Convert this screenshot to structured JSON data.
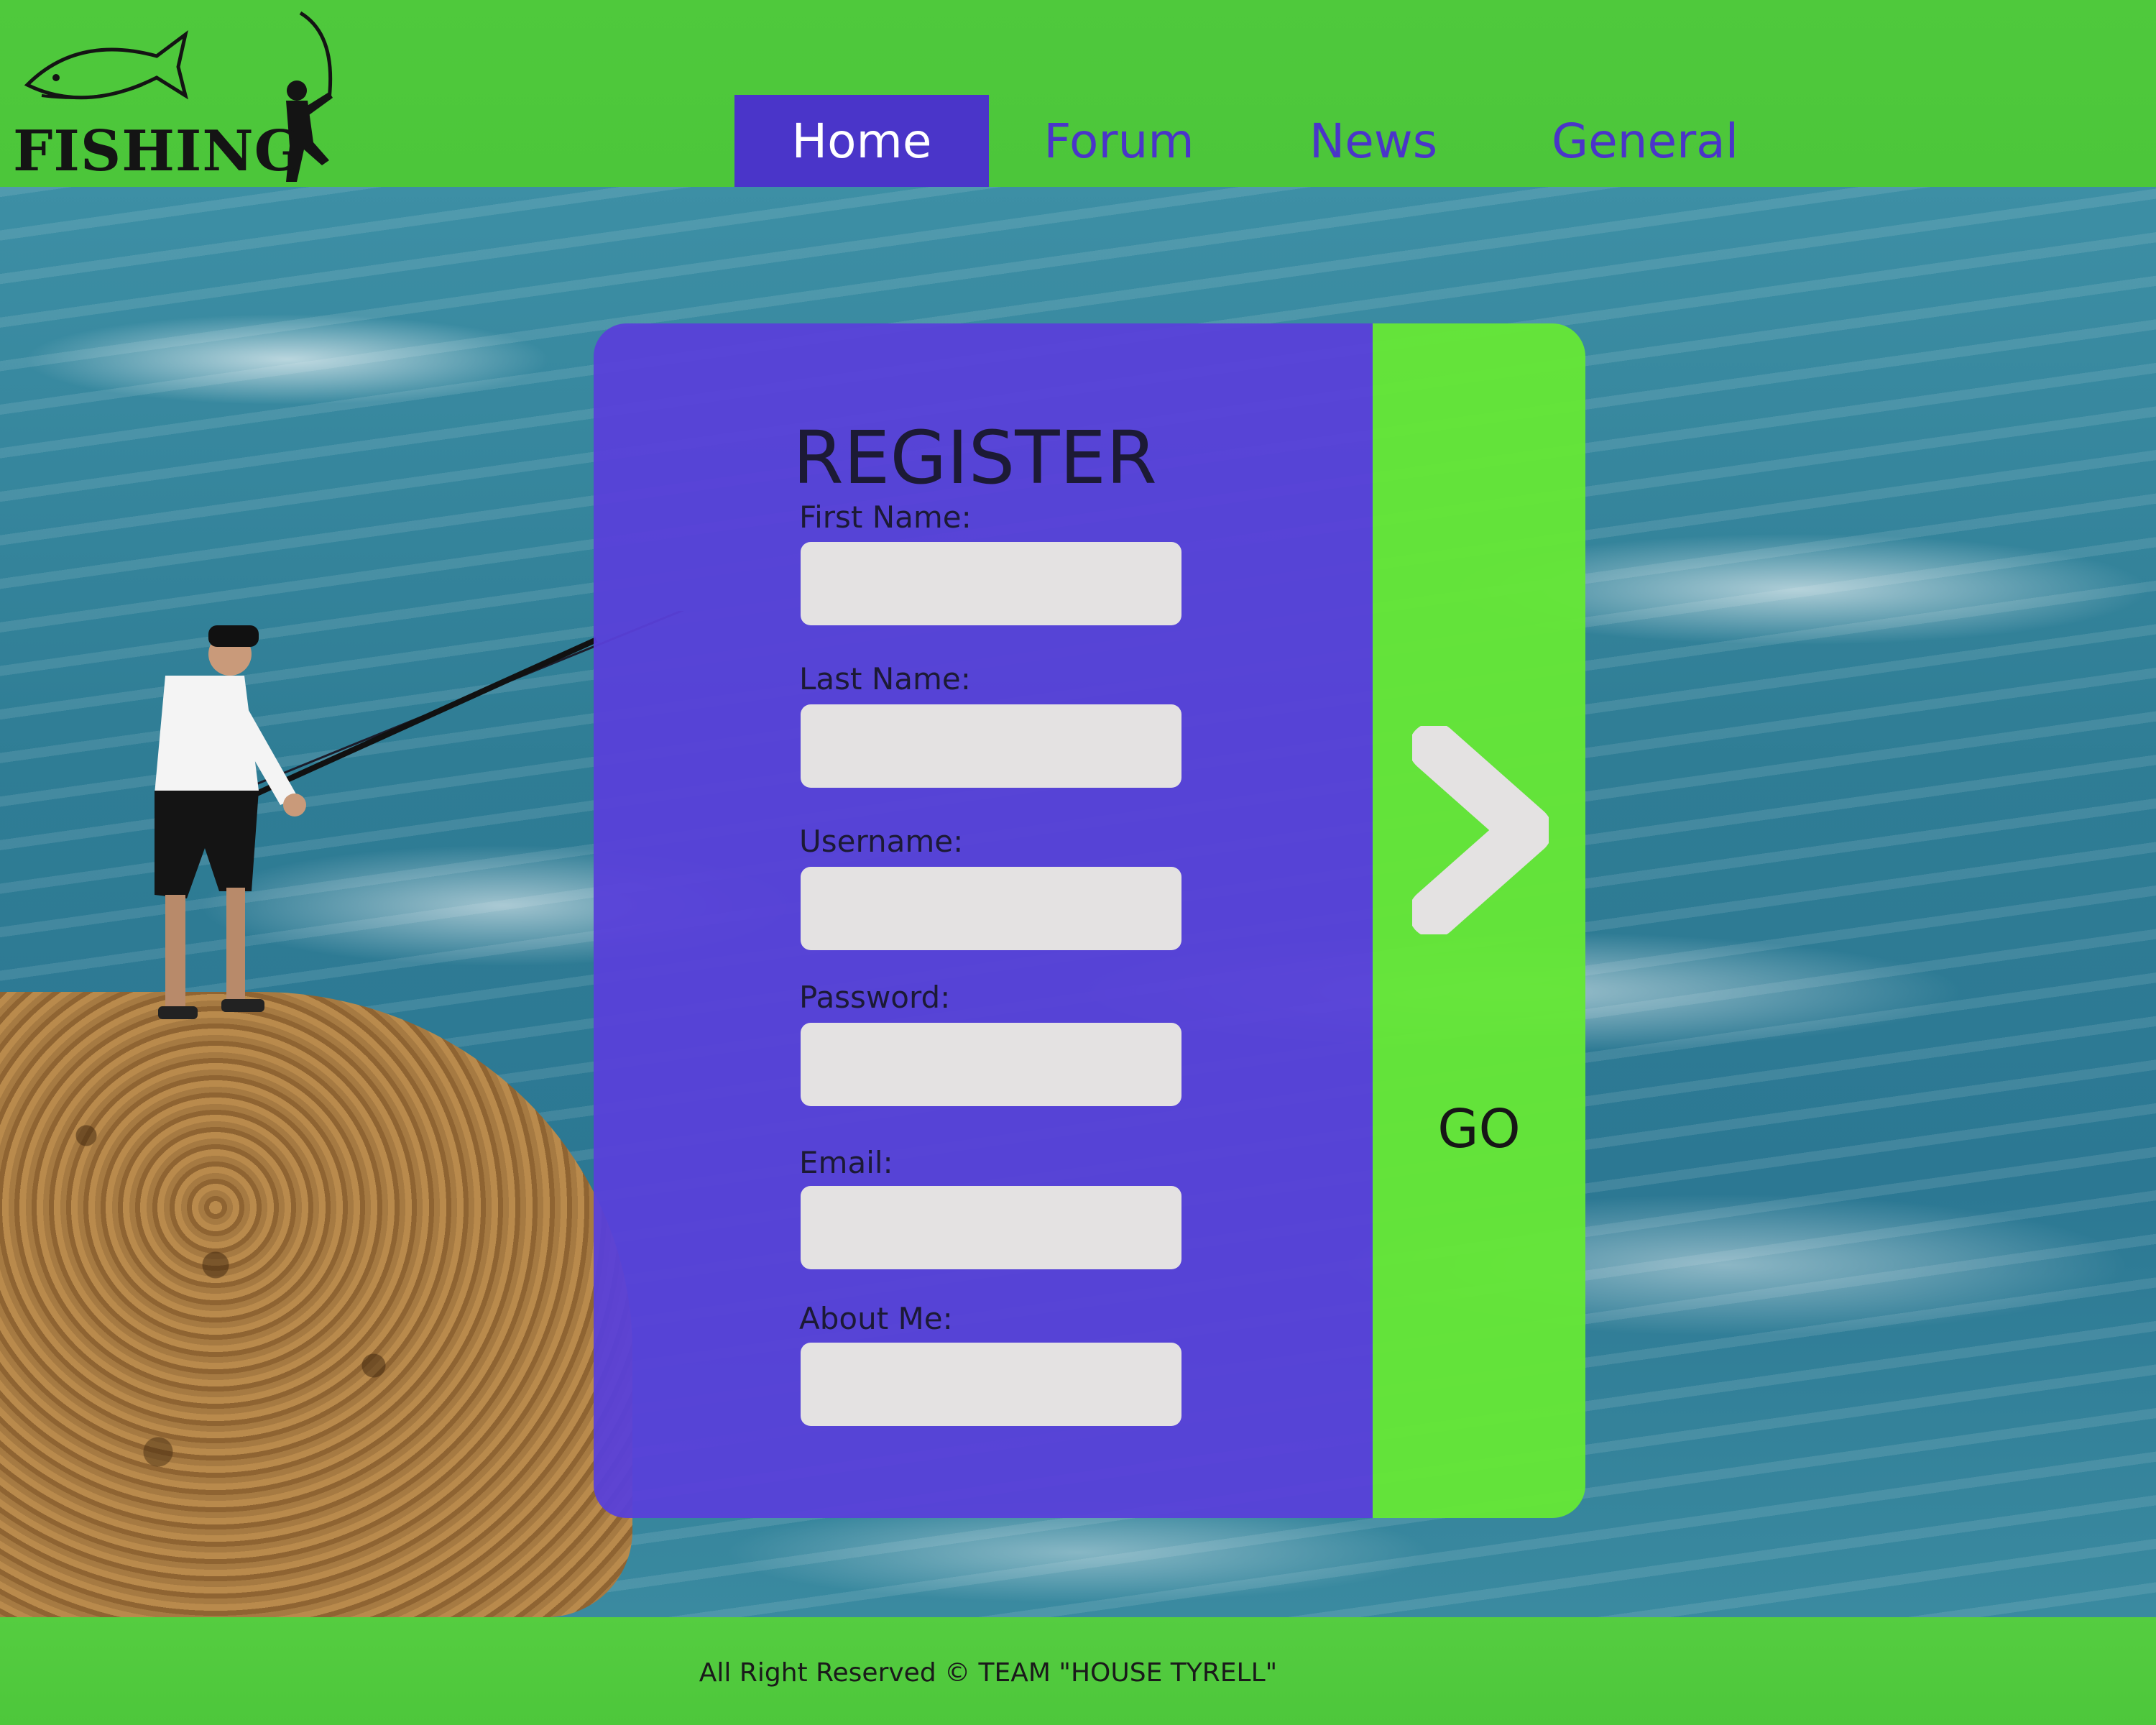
{
  "brand": {
    "name": "FISHING",
    "text_color": "#141414"
  },
  "nav": {
    "items": [
      {
        "label": "Home",
        "active": true
      },
      {
        "label": "Forum",
        "active": false
      },
      {
        "label": "News",
        "active": false
      },
      {
        "label": "General",
        "active": false
      }
    ],
    "color": "#4a35c9"
  },
  "form": {
    "title": "REGISTER",
    "fields": [
      {
        "label": "First Name:",
        "value": ""
      },
      {
        "label": "Last Name:",
        "value": ""
      },
      {
        "label": "Username:",
        "value": ""
      },
      {
        "label": "Password:",
        "value": ""
      },
      {
        "label": "Email:",
        "value": ""
      },
      {
        "label": "About Me:",
        "value": ""
      }
    ],
    "submit_label": "GO",
    "submit_icon": "chevron-right-icon",
    "panel_color": "#5840d9",
    "action_color": "#65e637"
  },
  "footer": {
    "text": "All Right Reserved © TEAM \"HOUSE TYRELL\""
  },
  "colors": {
    "header_green": "#4cc63a",
    "input_gray": "#e4e2e2"
  }
}
